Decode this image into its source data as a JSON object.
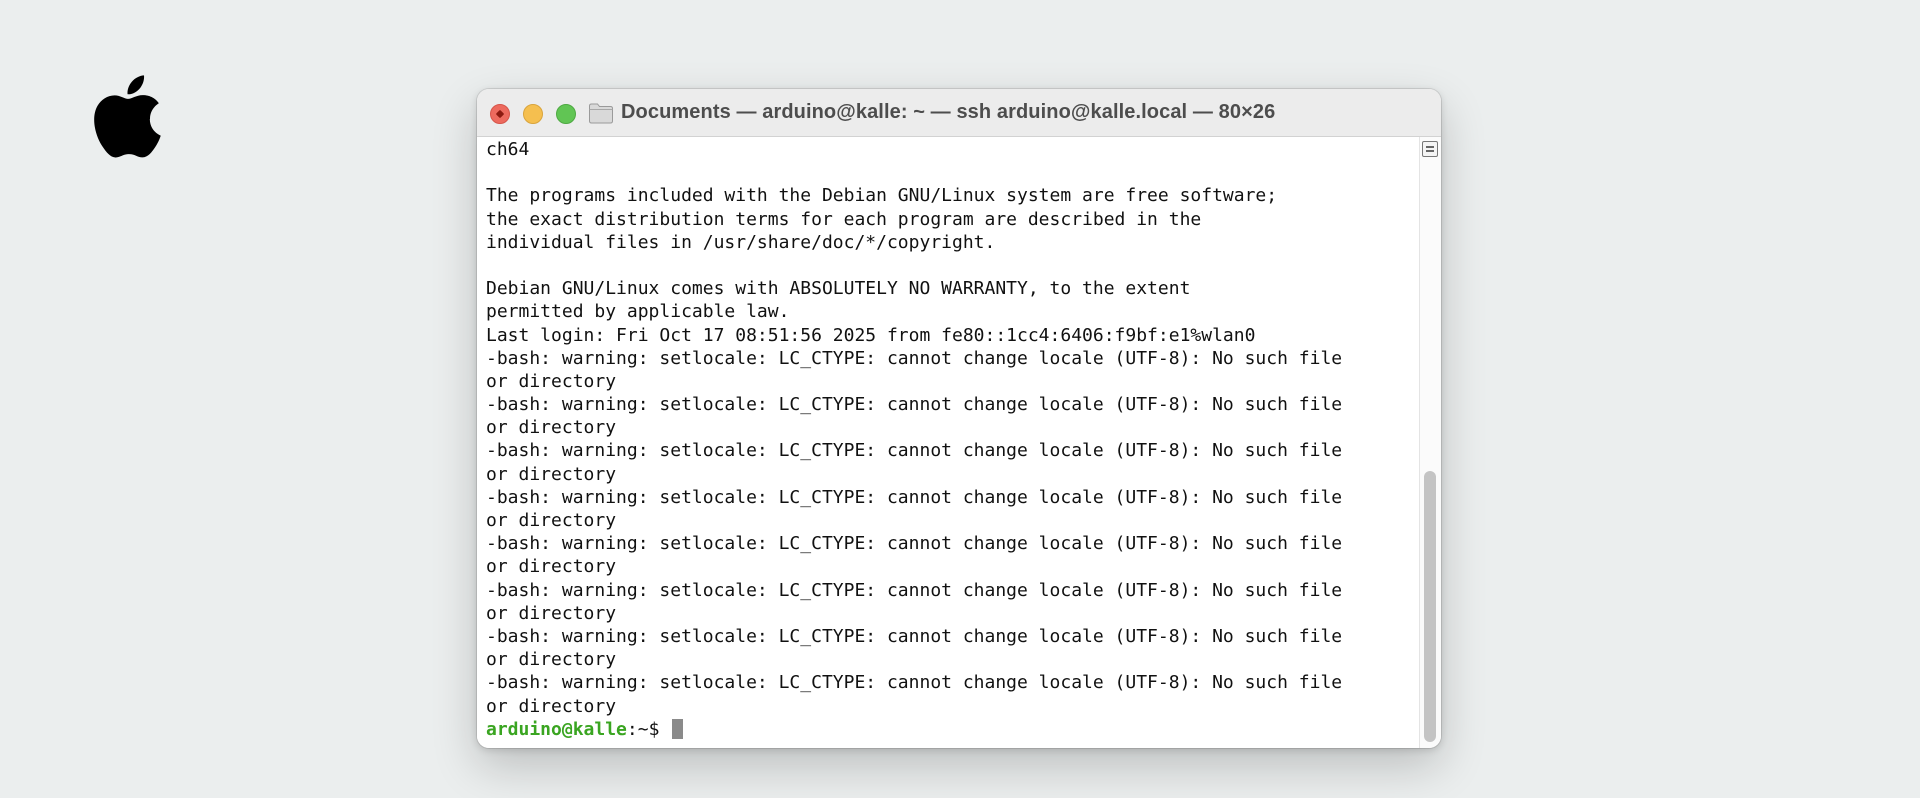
{
  "desktop": {
    "logo_icon": "apple-icon"
  },
  "window": {
    "title": "Documents — arduino@kalle: ~ — ssh arduino@kalle.local — 80×26",
    "folder_icon": "folder-icon",
    "controls": [
      "close",
      "minimize",
      "zoom"
    ],
    "colors": {
      "close": "#ed6a5e",
      "minimize": "#f5bf4f",
      "zoom": "#61c554"
    }
  },
  "terminal": {
    "lines": [
      "ch64",
      "",
      "The programs included with the Debian GNU/Linux system are free software;",
      "the exact distribution terms for each program are described in the",
      "individual files in /usr/share/doc/*/copyright.",
      "",
      "Debian GNU/Linux comes with ABSOLUTELY NO WARRANTY, to the extent",
      "permitted by applicable law.",
      "Last login: Fri Oct 17 08:51:56 2025 from fe80::1cc4:6406:f9bf:e1%wlan0",
      "-bash: warning: setlocale: LC_CTYPE: cannot change locale (UTF-8): No such file",
      "or directory",
      "-bash: warning: setlocale: LC_CTYPE: cannot change locale (UTF-8): No such file",
      "or directory",
      "-bash: warning: setlocale: LC_CTYPE: cannot change locale (UTF-8): No such file",
      "or directory",
      "-bash: warning: setlocale: LC_CTYPE: cannot change locale (UTF-8): No such file",
      "or directory",
      "-bash: warning: setlocale: LC_CTYPE: cannot change locale (UTF-8): No such file",
      "or directory",
      "-bash: warning: setlocale: LC_CTYPE: cannot change locale (UTF-8): No such file",
      "or directory",
      "-bash: warning: setlocale: LC_CTYPE: cannot change locale (UTF-8): No such file",
      "or directory",
      "-bash: warning: setlocale: LC_CTYPE: cannot change locale (UTF-8): No such file",
      "or directory"
    ],
    "prompt": {
      "user_host": "arduino@kalle",
      "path": ":~$ "
    },
    "prompt_color": "#3aa521"
  }
}
